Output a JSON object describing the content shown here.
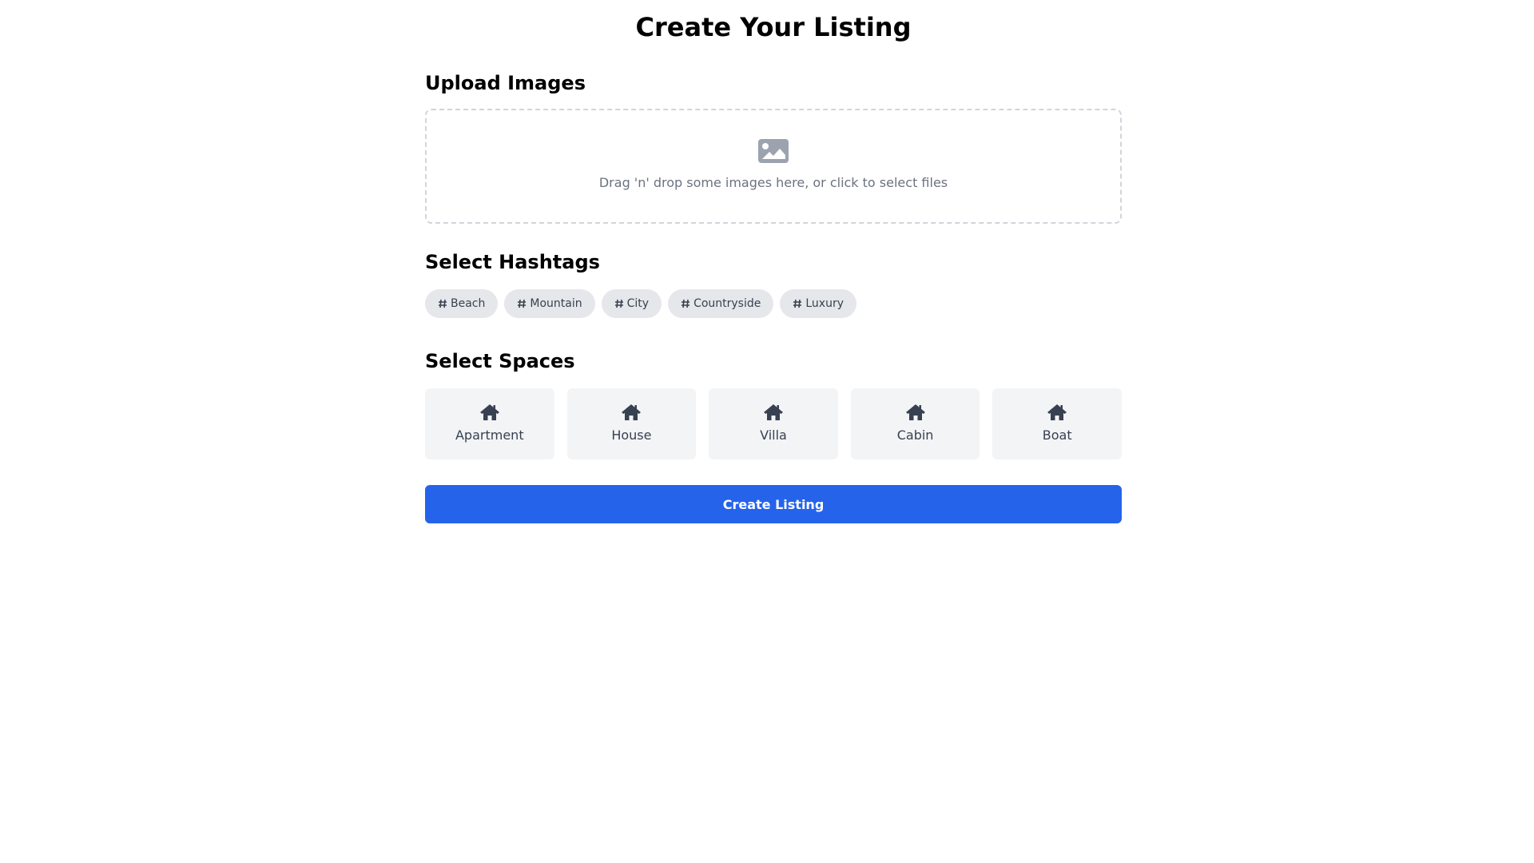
{
  "page": {
    "title": "Create Your Listing"
  },
  "upload": {
    "title": "Upload Images",
    "hint": "Drag 'n' drop some images here, or click to select files",
    "icon": "image-icon"
  },
  "hashtags": {
    "title": "Select Hashtags",
    "icon": "hash-icon",
    "items": [
      {
        "label": "Beach"
      },
      {
        "label": "Mountain"
      },
      {
        "label": "City"
      },
      {
        "label": "Countryside"
      },
      {
        "label": "Luxury"
      }
    ]
  },
  "spaces": {
    "title": "Select Spaces",
    "icon": "home-icon",
    "items": [
      {
        "label": "Apartment"
      },
      {
        "label": "House"
      },
      {
        "label": "Villa"
      },
      {
        "label": "Cabin"
      },
      {
        "label": "Boat"
      }
    ]
  },
  "actions": {
    "create_label": "Create Listing"
  },
  "colors": {
    "accent": "#2563eb",
    "tag_bg": "#e5e7eb",
    "space_bg": "#f3f4f6",
    "muted_text": "#6b7280",
    "icon": "#4b5563"
  }
}
